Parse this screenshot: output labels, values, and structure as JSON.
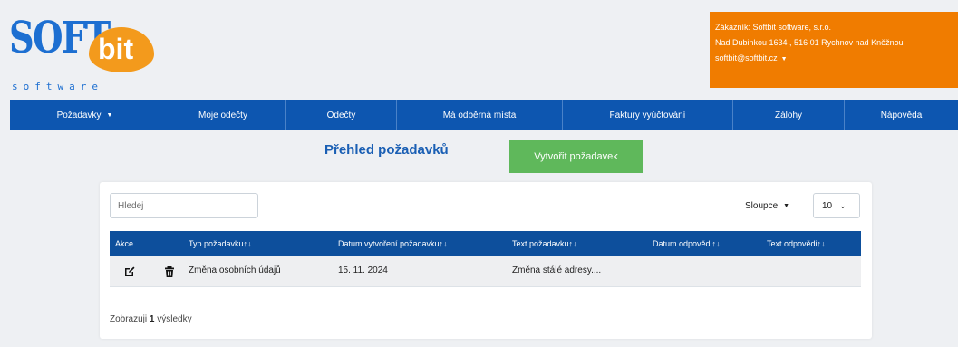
{
  "logo": {
    "soft": "SOFT",
    "bit": "bit",
    "tagline": "software"
  },
  "customer": {
    "line1": "Zákazník: Softbit software, s.r.o.",
    "line2": "Nad Dubinkou 1634 , 516 01 Rychnov nad Kněžnou",
    "email": "softbit@softbit.cz"
  },
  "nav": [
    {
      "label": "Požadavky",
      "dropdown": true
    },
    {
      "label": "Moje odečty"
    },
    {
      "label": "Odečty"
    },
    {
      "label": "Má odběrná místa"
    },
    {
      "label": "Faktury vyúčtování"
    },
    {
      "label": "Zálohy"
    },
    {
      "label": "Nápověda"
    }
  ],
  "page": {
    "title": "Přehled požadavků",
    "create_label": "Vytvořit požadavek"
  },
  "toolbar": {
    "search_placeholder": "Hledej",
    "columns_label": "Sloupce",
    "page_size": "10"
  },
  "table": {
    "headers": [
      "Akce",
      "Typ požadavku↑↓",
      "Datum vytvoření požadavku↑↓",
      "Text požadavku↑↓",
      "Datum odpovědi↑↓",
      "Text odpovědi↑↓"
    ],
    "rows": [
      {
        "type": "Změna osobních údajů",
        "created": "15. 11. 2024",
        "text": "Změna stálé adresy....",
        "answer_date": "",
        "answer_text": ""
      }
    ]
  },
  "footer": {
    "prefix": "Zobrazuji",
    "count": "1",
    "suffix": "výsledky"
  },
  "colors": {
    "nav": "#0d56b0",
    "accent": "#f07c00",
    "create": "#5fb85b",
    "table_head": "#0d4f9c"
  }
}
